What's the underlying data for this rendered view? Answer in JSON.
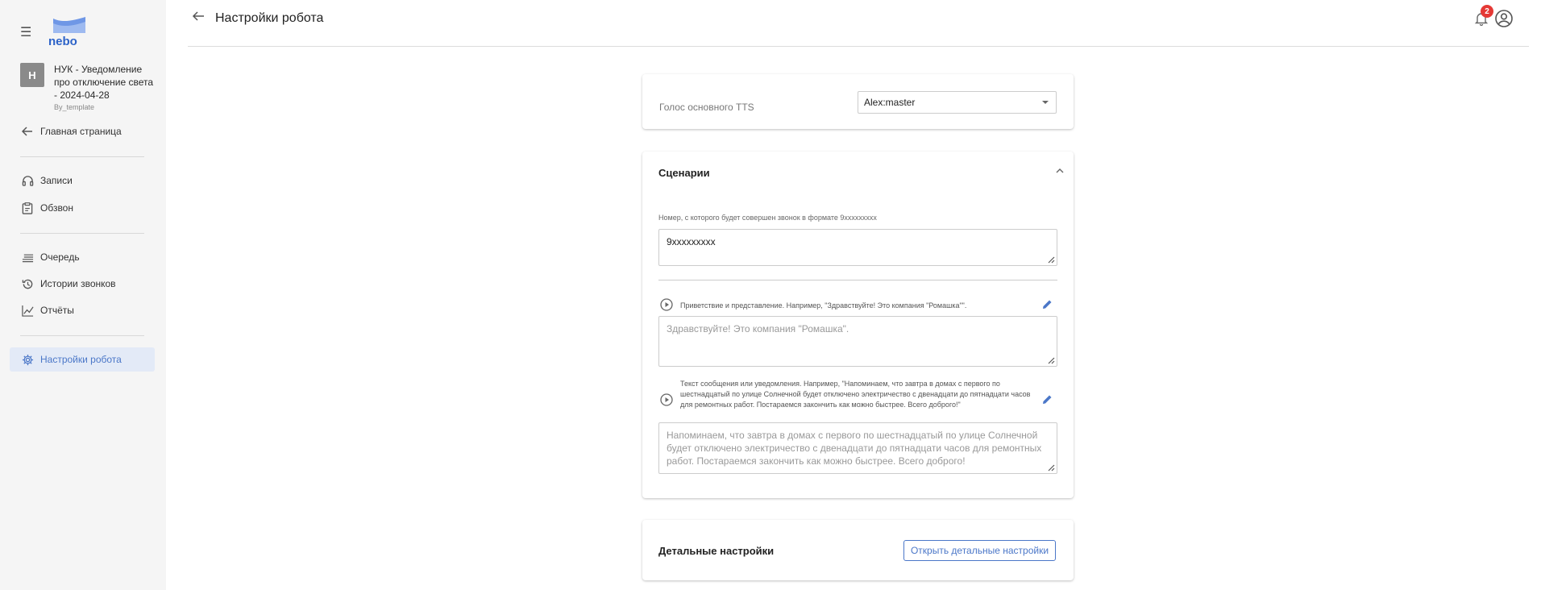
{
  "app": {
    "logo_text": "nebo",
    "brand_color": "#4b77c8"
  },
  "project": {
    "avatar_letter": "Н",
    "name": "НУК - Уведомление про отключение света - 2024-04-28",
    "subtitle": "By_template"
  },
  "sidebar": {
    "home": {
      "label": "Главная страница",
      "icon": "arrow-left-icon"
    },
    "items": [
      {
        "label": "Записи",
        "icon": "headphones-icon"
      },
      {
        "label": "Обзвон",
        "icon": "clipboard-icon"
      },
      {
        "label": "Очередь",
        "icon": "queue-icon"
      },
      {
        "label": "Истории звонков",
        "icon": "history-icon"
      },
      {
        "label": "Отчёты",
        "icon": "chart-icon"
      },
      {
        "label": "Настройки робота",
        "icon": "gear-icon",
        "active": true
      }
    ]
  },
  "header": {
    "title": "Настройки робота",
    "notifications_count": "2"
  },
  "tts": {
    "label": "Голос основного TTS",
    "selected": "Alex:master"
  },
  "scenarios": {
    "title": "Сценарии",
    "phone_label": "Номер, с которого будет совершен звонок в формате 9xxxxxxxxx",
    "phone_value": "9xxxxxxxxx",
    "greeting_prompt": "Приветствие и представление. Например, \"Здравствуйте! Это компания \"Ромашка\"\".",
    "greeting_placeholder": "Здравствуйте! Это компания \"Ромашка\".",
    "message_prompt": "Текст сообщения или уведомления. Например, \"Напоминаем, что завтра в домах с первого по шестнадцатый по улице Солнечной будет отключено электричество с двенадцати до пятнадцати часов для ремонтных работ. Постараемся закончить как можно быстрее. Всего доброго!\"",
    "message_placeholder": "Напоминаем, что завтра в домах с первого по шестнадцатый по улице Солнечной будет отключено электричество с двенадцати до пятнадцати часов для ремонтных работ. Постараемся закончить как можно быстрее. Всего доброго!"
  },
  "details": {
    "title": "Детальные настройки",
    "button_label": "Открыть детальные настройки"
  }
}
